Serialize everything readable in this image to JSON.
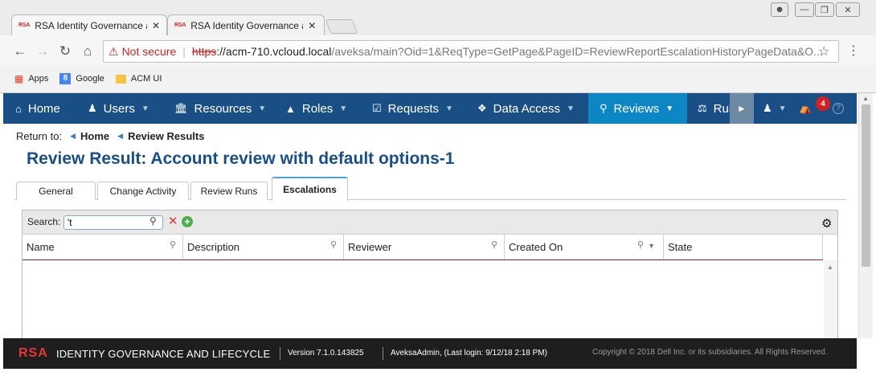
{
  "browser": {
    "tabs": [
      {
        "favicon": "RSA",
        "title": "RSA Identity Governance ar",
        "close": "✕"
      },
      {
        "favicon": "RSA",
        "title": "RSA Identity Governance ar",
        "close": "✕"
      }
    ],
    "security_label": "Not secure",
    "url_protocol": "https",
    "url_host": "://acm-710.vcloud.local",
    "url_path": "/aveksa/main?Oid=1&ReqType=GetPage&PageID=ReviewReportEscalationHistoryPageData&O...",
    "bookmarks": [
      {
        "label": "Apps",
        "icon": "apps-grid-icon"
      },
      {
        "label": "Google",
        "icon": "google-icon"
      },
      {
        "label": "ACM UI",
        "icon": "folder-icon"
      }
    ]
  },
  "nav": {
    "items": [
      {
        "label": "Home",
        "icon": "home-icon"
      },
      {
        "label": "Users",
        "icon": "users-icon"
      },
      {
        "label": "Resources",
        "icon": "bank-icon"
      },
      {
        "label": "Roles",
        "icon": "roles-icon"
      },
      {
        "label": "Requests",
        "icon": "clipboard-check-icon"
      },
      {
        "label": "Data Access",
        "icon": "cubes-icon"
      },
      {
        "label": "Reviews",
        "icon": "lightbulb-icon"
      },
      {
        "label": "Rules",
        "icon": "scales-icon"
      }
    ],
    "alerts_count": "4"
  },
  "breadcrumb": {
    "prefix": "Return to:",
    "items": [
      "Home",
      "Review Results"
    ]
  },
  "page": {
    "title": "Review Result: Account review with default options-1",
    "tabs": [
      "General",
      "Change Activity",
      "Review Runs",
      "Escalations"
    ],
    "active_tab": "Escalations"
  },
  "grid": {
    "search_label": "Search:",
    "search_value": "'t",
    "columns": [
      "Name",
      "Description",
      "Reviewer",
      "Created On",
      "State"
    ]
  },
  "footer": {
    "logo": "RSA",
    "product": "IDENTITY GOVERNANCE AND LIFECYCLE",
    "version": "Version 7.1.0.143825",
    "user": "AveksaAdmin, (Last login: 9/12/18 2:18 PM)",
    "copyright": "Copyright © 2018 Dell Inc. or its subsidiaries. All Rights Reserved."
  },
  "colors": {
    "nav_bg": "#1a4f86",
    "nav_active": "#0d86c6",
    "title": "#1a4f86",
    "footer_bg": "#1e1e1e",
    "rsa_red": "#e53935"
  }
}
